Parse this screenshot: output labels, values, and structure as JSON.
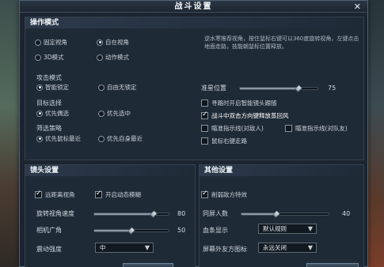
{
  "window": {
    "title": "战斗设置",
    "close_icon": "close-icon"
  },
  "ops": {
    "header": "操作模式",
    "view_modes": [
      {
        "label": "固定视角",
        "selected": false
      },
      {
        "label": "自在视角",
        "selected": true
      },
      {
        "label": "3D模式",
        "selected": false
      },
      {
        "label": "动作模式",
        "selected": false
      }
    ],
    "description": "逆水寒推荐视角，按住鼠标右键可以360度旋转视角，左键点击地面走路，技能朝鼠标位置释放。",
    "attack_mode": {
      "title": "攻击模式",
      "options": [
        {
          "label": "智能锁定",
          "selected": true
        },
        {
          "label": "自由无锁定",
          "selected": false
        }
      ]
    },
    "target_select": {
      "title": "目标选择",
      "options": [
        {
          "label": "优先偶选",
          "selected": true
        },
        {
          "label": "优先选中",
          "selected": false
        }
      ]
    },
    "filter_strategy": {
      "title": "筛选策略",
      "options": [
        {
          "label": "优先鼠标最近",
          "selected": true
        },
        {
          "label": "优先自身最近",
          "selected": false
        }
      ]
    },
    "crosshair": {
      "label": "准星位置",
      "value": "75",
      "fraction": 0.75
    },
    "options": [
      {
        "label": "寻路时开启智能镜头跟随",
        "checked": false
      },
      {
        "label": "战斗中双击方向键释放蒸回风",
        "checked": true
      },
      {
        "label": "瞄准指示线(对敌人)",
        "checked": false
      },
      {
        "label": "瞄准指示线(对队友)",
        "checked": false
      },
      {
        "label": "鼠标右键走路",
        "checked": false
      }
    ]
  },
  "camera": {
    "header": "镜头设置",
    "far_view": {
      "label": "远距离视角",
      "checked": true
    },
    "motion_blur": {
      "label": "开启动态模糊",
      "checked": true
    },
    "rotate_speed": {
      "label": "旋转视角速度",
      "value": "80",
      "fraction": 0.8
    },
    "fov": {
      "label": "相机广角",
      "value": "50",
      "fraction": 0.5
    },
    "shake": {
      "label": "震动强度",
      "value": "中"
    }
  },
  "other": {
    "header": "其他设置",
    "weaken_enemy": {
      "label": "削弱敌方特效",
      "checked": true
    },
    "same_screen": {
      "label": "同屏人数",
      "value": "40",
      "fraction": 0.4
    },
    "hp_bar": {
      "label": "血条显示",
      "value": "默认规则"
    },
    "friendly_icon": {
      "label": "屏幕外友方图标",
      "value": "永远关闭"
    }
  }
}
